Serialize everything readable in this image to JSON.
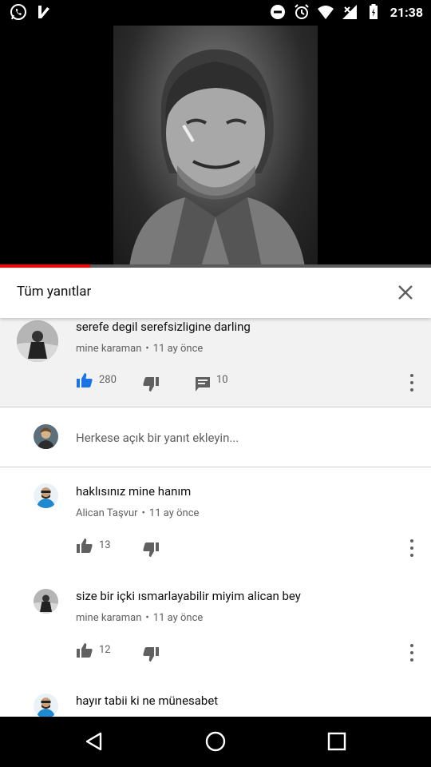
{
  "status_bar": {
    "time": "21:38"
  },
  "player": {
    "progress_fraction": 0.21
  },
  "replies_panel": {
    "title": "Tüm yanıtlar",
    "parent_comment": {
      "text": "serefe degil serefsizligine darling",
      "author": "mine karaman",
      "separator": "•",
      "time_ago": "11 ay önce",
      "likes": "280",
      "replies": "10"
    },
    "add_reply_placeholder": "Herkese açık bir yanıt ekleyin...",
    "replies": [
      {
        "text": "haklısınız mine hanım",
        "author": "Alican Taşvur",
        "separator": "•",
        "time_ago": "11 ay önce",
        "likes": "13"
      },
      {
        "text": "size bir içki ısmarlayabilir miyim alican bey",
        "author": "mine karaman",
        "separator": "•",
        "time_ago": "11 ay önce",
        "likes": "12"
      },
      {
        "text": "hayır tabii ki ne münesabet"
      }
    ]
  },
  "colors": {
    "accent_red": "#ff0000",
    "like_blue": "#1a73e8",
    "meta_gray": "#606060"
  }
}
